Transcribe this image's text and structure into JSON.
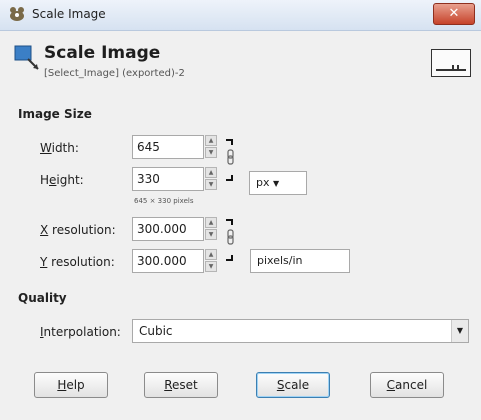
{
  "window": {
    "title": "Scale Image",
    "close_icon": "close-icon"
  },
  "header": {
    "title": "Scale Image",
    "subtitle": "[Select_Image] (exported)-2",
    "icon": "scale-image-icon",
    "preview_icon": "preview-thumbnail-icon"
  },
  "image_size": {
    "section_label": "Image Size",
    "width": {
      "label_u": "W",
      "label_rest": "idth:",
      "value": "645"
    },
    "height": {
      "label_pre": "H",
      "label_u": "e",
      "label_rest": "ight:",
      "value": "330"
    },
    "pixel_hint": "645 × 330 pixels",
    "size_unit": "px",
    "x_resolution": {
      "label_u": "X",
      "label_rest": " resolution:",
      "value": "300.000"
    },
    "y_resolution": {
      "label_u": "Y",
      "label_rest": " resolution:",
      "value": "300.000"
    },
    "resolution_unit": "pixels/in"
  },
  "quality": {
    "section_label": "Quality",
    "interpolation_label_u": "I",
    "interpolation_label_rest": "nterpolation:",
    "interpolation_value": "Cubic"
  },
  "buttons": {
    "help": {
      "u": "H",
      "rest": "elp"
    },
    "reset": {
      "u": "R",
      "rest": "eset"
    },
    "scale": {
      "u": "S",
      "rest": "cale"
    },
    "cancel": {
      "u": "C",
      "rest": "ancel"
    }
  }
}
